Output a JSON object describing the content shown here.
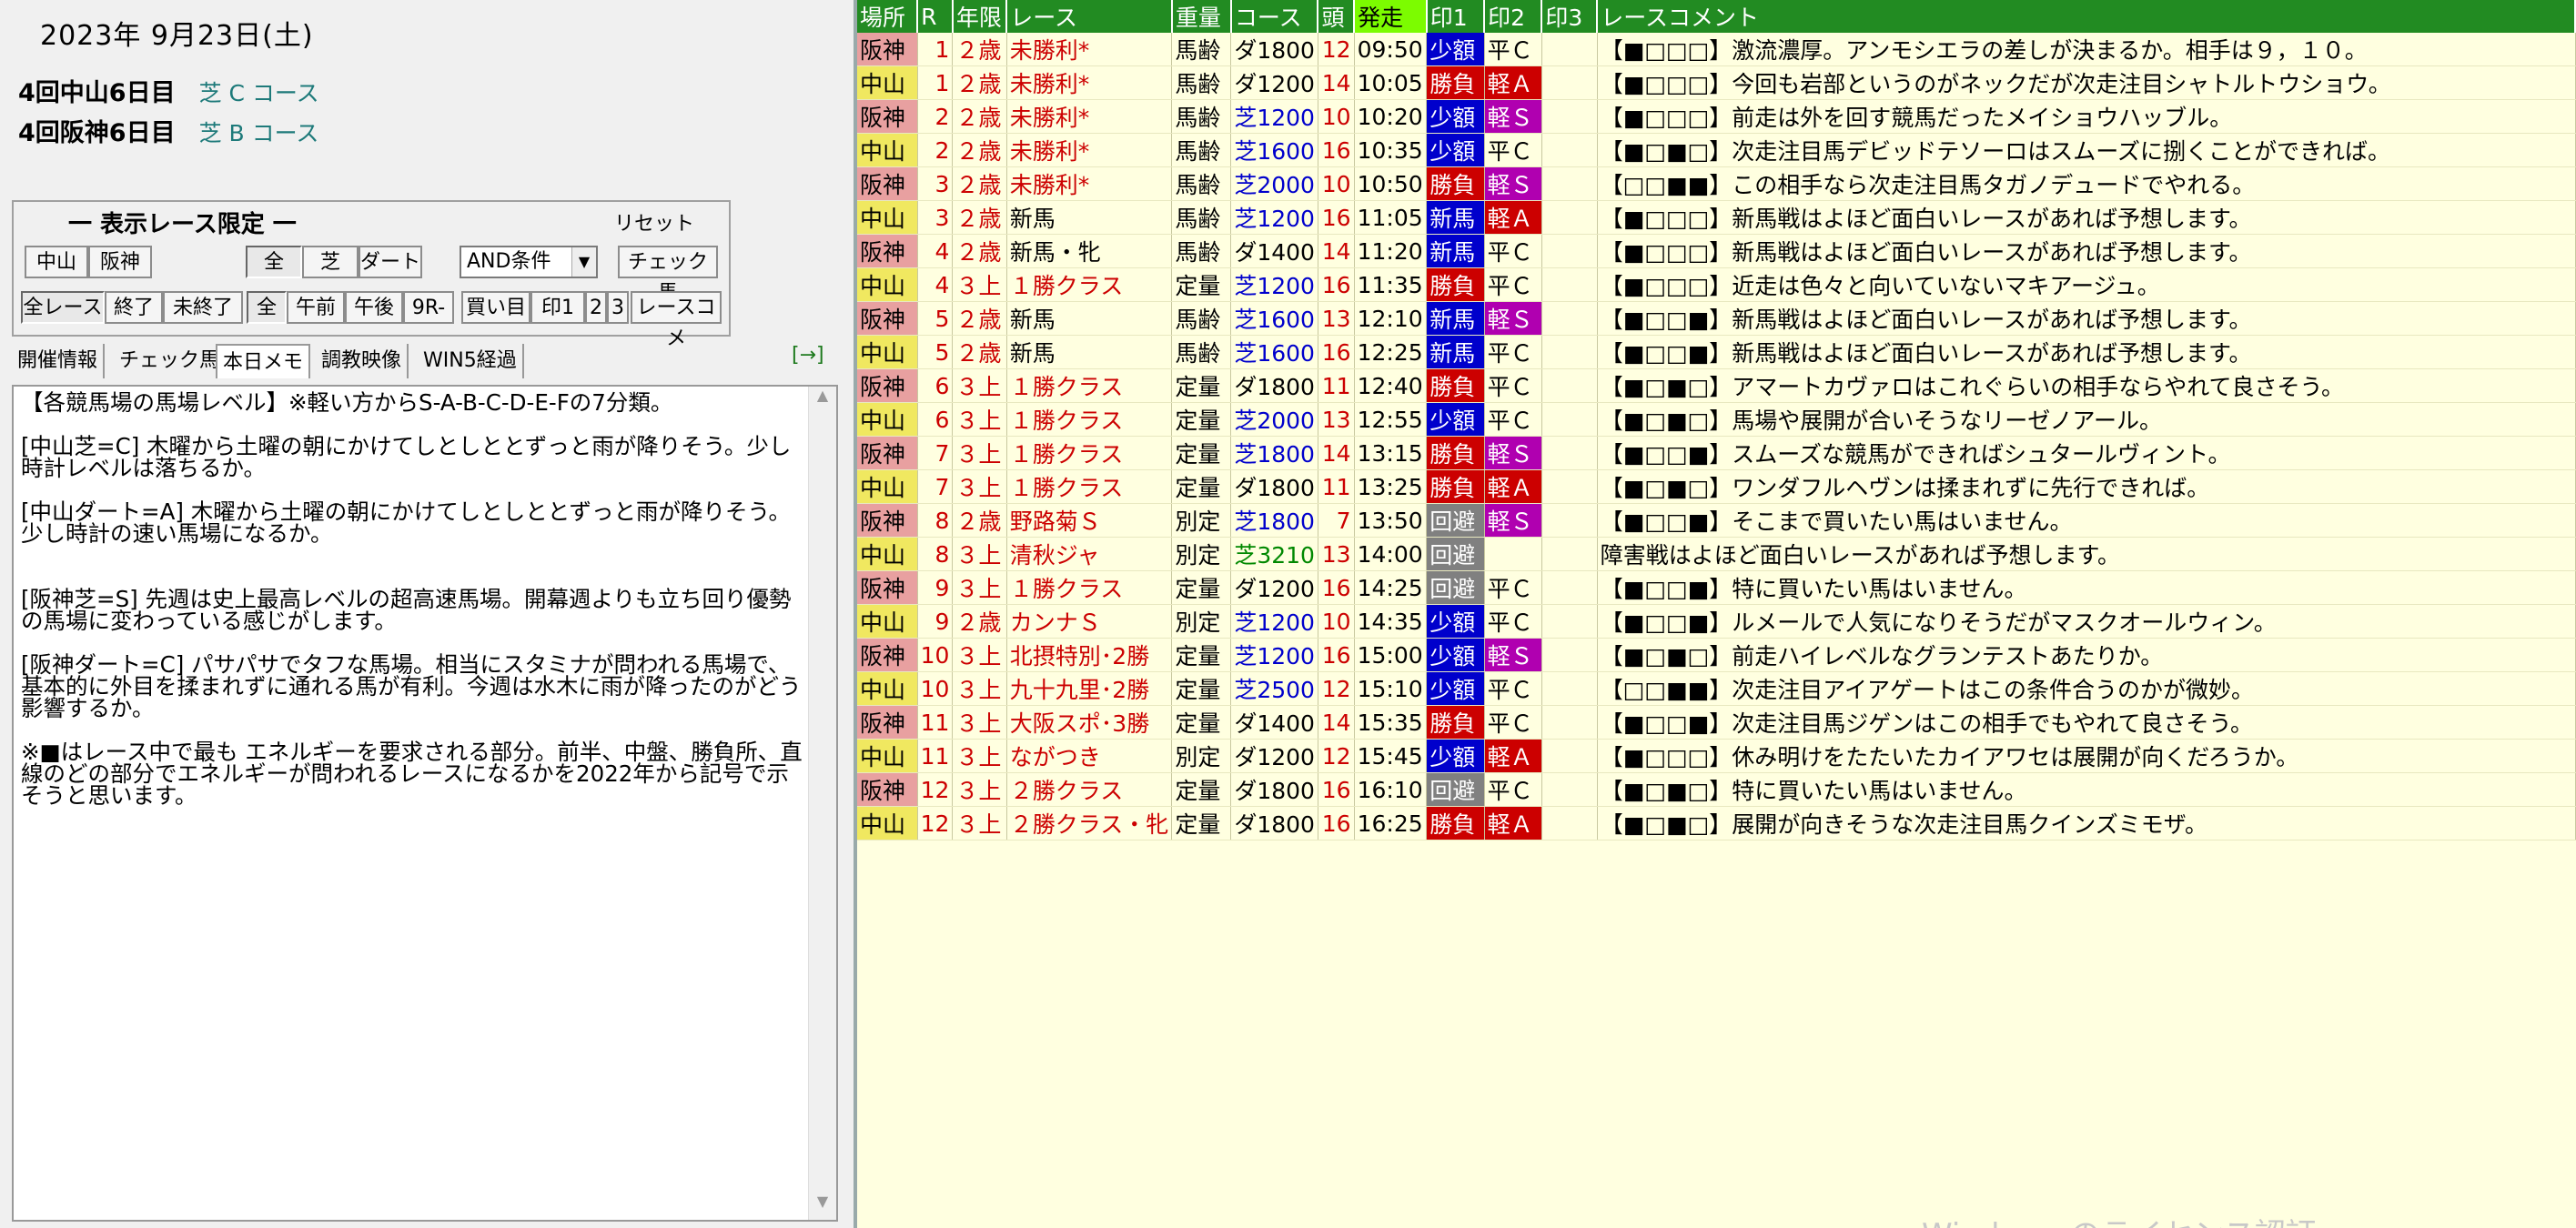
{
  "left": {
    "date": "2023年  9月23日(土)",
    "venues": [
      {
        "name": "4回中山6日目",
        "course": "芝 C コース"
      },
      {
        "name": "4回阪神6日目",
        "course": "芝 B コース"
      }
    ],
    "filter": {
      "title": "一   表示レース限定   一",
      "reset": "リセット",
      "buttons_row1": [
        "中山",
        "阪神",
        "全",
        "芝",
        "ダート"
      ],
      "select_value": "AND条件",
      "check_horse": "チェック馬",
      "buttons_row2": [
        "全レース",
        "終了",
        "未終了",
        "全",
        "午前",
        "午後",
        "9R-",
        "買い目",
        "印1",
        "2",
        "3",
        "レースコメ"
      ]
    },
    "tabs": [
      "開催情報",
      "チェック馬",
      "本日メモ",
      "調教映像",
      "WIN5経過"
    ],
    "tab_arrow": "[→]",
    "memo": "【各競馬場の馬場レベル】※軽い方からS-A-B-C-D-E-Fの7分類。\n\n[中山芝=C] 木曜から土曜の朝にかけてしとしととずっと雨が降りそう。少し時計レベルは落ちるか。\n\n[中山ダート=A] 木曜から土曜の朝にかけてしとしととずっと雨が降りそう。少し時計の速い馬場になるか。\n\n\n[阪神芝=S] 先週は史上最高レベルの超高速馬場。開幕週よりも立ち回り優勢の馬場に変わっている感じがします。\n\n[阪神ダート=C] パサパサでタフな馬場。相当にスタミナが問われる馬場で、基本的に外目を揉まれずに通れる馬が有利。今週は水木に雨が降ったのがどう影響するか。\n\n※■はレース中で最も エネルギーを要求される部分。前半、中盤、勝負所、直線のどの部分でエネルギーが問われるレースになるかを2022年から記号で示そうと思います。"
  },
  "table": {
    "headers": [
      "場所",
      "R",
      "年限",
      "レース",
      "重量",
      "コース",
      "頭",
      "発走",
      "印1",
      "印2",
      "印3",
      "レースコメント"
    ],
    "rows": [
      [
        "阪神",
        "1",
        "２歳",
        "未勝利*",
        "馬齢",
        "ダ1800",
        "12",
        "09:50",
        "少額",
        "平Ｃ",
        "",
        "【■□□□】激流濃厚。アンモシエラの差しが決まるか。相手は９，１０。"
      ],
      [
        "中山",
        "1",
        "２歳",
        "未勝利*",
        "馬齢",
        "ダ1200",
        "14",
        "10:05",
        "勝負",
        "軽Ａ",
        "",
        "【■□□□】今回も岩部というのがネックだが次走注目シャトルトウショウ。"
      ],
      [
        "阪神",
        "2",
        "２歳",
        "未勝利*",
        "馬齢",
        "芝1200",
        "10",
        "10:20",
        "少額",
        "軽Ｓ",
        "",
        "【■□□□】前走は外を回す競馬だったメイショウハッブル。"
      ],
      [
        "中山",
        "2",
        "２歳",
        "未勝利*",
        "馬齢",
        "芝1600",
        "16",
        "10:35",
        "少額",
        "平Ｃ",
        "",
        "【■□■□】次走注目馬デビッドテソーロはスムーズに捌くことができれば。"
      ],
      [
        "阪神",
        "3",
        "２歳",
        "未勝利*",
        "馬齢",
        "芝2000",
        "10",
        "10:50",
        "勝負",
        "軽Ｓ",
        "",
        "【□□■■】この相手なら次走注目馬タガノデュードでやれる。"
      ],
      [
        "中山",
        "3",
        "２歳",
        "新馬",
        "馬齢",
        "芝1200",
        "16",
        "11:05",
        "新馬",
        "軽Ａ",
        "",
        "【■□□□】新馬戦はよほど面白いレースがあれば予想します。"
      ],
      [
        "阪神",
        "4",
        "２歳",
        "新馬・牝",
        "馬齢",
        "ダ1400",
        "14",
        "11:20",
        "新馬",
        "平Ｃ",
        "",
        "【■□□□】新馬戦はよほど面白いレースがあれば予想します。"
      ],
      [
        "中山",
        "4",
        "３上",
        "１勝クラス",
        "定量",
        "芝1200",
        "16",
        "11:35",
        "勝負",
        "平Ｃ",
        "",
        "【■□□□】近走は色々と向いていないマキアージュ。"
      ],
      [
        "阪神",
        "5",
        "２歳",
        "新馬",
        "馬齢",
        "芝1600",
        "13",
        "12:10",
        "新馬",
        "軽Ｓ",
        "",
        "【■□□■】新馬戦はよほど面白いレースがあれば予想します。"
      ],
      [
        "中山",
        "5",
        "２歳",
        "新馬",
        "馬齢",
        "芝1600",
        "16",
        "12:25",
        "新馬",
        "平Ｃ",
        "",
        "【■□□■】新馬戦はよほど面白いレースがあれば予想します。"
      ],
      [
        "阪神",
        "6",
        "３上",
        "１勝クラス",
        "定量",
        "ダ1800",
        "11",
        "12:40",
        "勝負",
        "平Ｃ",
        "",
        "【■□■□】アマートカヴァロはこれぐらいの相手ならやれて良さそう。"
      ],
      [
        "中山",
        "6",
        "３上",
        "１勝クラス",
        "定量",
        "芝2000",
        "13",
        "12:55",
        "少額",
        "平Ｃ",
        "",
        "【■□■□】馬場や展開が合いそうなリーゼノアール。"
      ],
      [
        "阪神",
        "7",
        "３上",
        "１勝クラス",
        "定量",
        "芝1800",
        "14",
        "13:15",
        "勝負",
        "軽Ｓ",
        "",
        "【■□□■】スムーズな競馬ができればシュタールヴィント。"
      ],
      [
        "中山",
        "7",
        "３上",
        "１勝クラス",
        "定量",
        "ダ1800",
        "11",
        "13:25",
        "勝負",
        "軽Ａ",
        "",
        "【■□■□】ワンダフルヘヴンは揉まれずに先行できれば。"
      ],
      [
        "阪神",
        "8",
        "２歳",
        "野路菊Ｓ",
        "別定",
        "芝1800",
        "7",
        "13:50",
        "回避",
        "軽Ｓ",
        "",
        "【■□□■】そこまで買いたい馬はいません。"
      ],
      [
        "中山",
        "8",
        "３上",
        "清秋ジャ",
        "別定",
        "芝3210",
        "13",
        "14:00",
        "回避",
        "",
        "",
        "障害戦はよほど面白いレースがあれば予想します。"
      ],
      [
        "阪神",
        "9",
        "３上",
        "１勝クラス",
        "定量",
        "ダ1200",
        "16",
        "14:25",
        "回避",
        "平Ｃ",
        "",
        "【■□□■】特に買いたい馬はいません。"
      ],
      [
        "中山",
        "9",
        "２歳",
        "カンナＳ",
        "別定",
        "芝1200",
        "10",
        "14:35",
        "少額",
        "平Ｃ",
        "",
        "【■□□■】ルメールで人気になりそうだがマスクオールウィン。"
      ],
      [
        "阪神",
        "10",
        "３上",
        "北摂特別･2勝",
        "定量",
        "芝1200",
        "16",
        "15:00",
        "少額",
        "軽Ｓ",
        "",
        "【■□■□】前走ハイレベルなグランテストあたりか。"
      ],
      [
        "中山",
        "10",
        "３上",
        "九十九里･2勝",
        "定量",
        "芝2500",
        "12",
        "15:10",
        "少額",
        "平Ｃ",
        "",
        "【□□■■】次走注目アイアゲートはこの条件合うのかが微妙。"
      ],
      [
        "阪神",
        "11",
        "３上",
        "大阪スポ･3勝",
        "定量",
        "ダ1400",
        "14",
        "15:35",
        "勝負",
        "平Ｃ",
        "",
        "【■□□■】次走注目馬ジゲンはこの相手でもやれて良さそう。"
      ],
      [
        "中山",
        "11",
        "３上",
        "ながつき",
        "別定",
        "ダ1200",
        "12",
        "15:45",
        "少額",
        "軽Ａ",
        "",
        "【■□□□】休み明けをたたいたカイアワセは展開が向くだろうか。"
      ],
      [
        "阪神",
        "12",
        "３上",
        "２勝クラス",
        "定量",
        "ダ1800",
        "16",
        "16:10",
        "回避",
        "平Ｃ",
        "",
        "【■□■□】特に買いたい馬はいません。"
      ],
      [
        "中山",
        "12",
        "３上",
        "２勝クラス・牝",
        "定量",
        "ダ1800",
        "16",
        "16:25",
        "勝負",
        "軽Ａ",
        "",
        "【■□■□】展開が向きそうな次走注目馬クインズミモザ。"
      ]
    ]
  },
  "watermark": "Windows のライセンス認証"
}
